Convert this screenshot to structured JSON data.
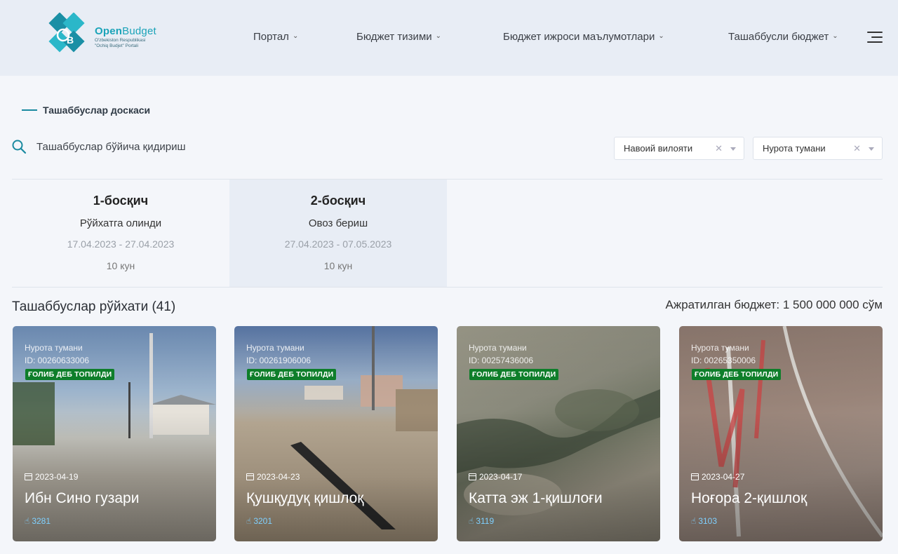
{
  "logo": {
    "name_bold": "Open",
    "name_light": "Budget",
    "sub1": "O'zbekiston Respublikasi",
    "sub2": "\"Ochiq Budjet\" Portali"
  },
  "nav": [
    {
      "label": "Портал"
    },
    {
      "label": "Бюджет тизими"
    },
    {
      "label": "Бюджет ижроси маълумотлари"
    },
    {
      "label": "Ташаббусли бюджет"
    }
  ],
  "section": {
    "label": "Ташаббуслар доскаси"
  },
  "search": {
    "placeholder": "Ташаббуслар бўйича қидириш"
  },
  "filters": {
    "region": "Навоий вилояти",
    "district": "Нурота тумани"
  },
  "stages": [
    {
      "title": "1-босқич",
      "name": "Рўйхатга олинди",
      "dates": "17.04.2023 - 27.04.2023",
      "days": "10 кун",
      "active": false
    },
    {
      "title": "2-босқич",
      "name": "Овоз бериш",
      "dates": "27.04.2023 - 07.05.2023",
      "days": "10 кун",
      "active": true
    }
  ],
  "list": {
    "title": "Ташаббуслар рўйхати (41)",
    "budget": "Ажратилган бюджет: 1 500 000 000 сўм"
  },
  "cards": [
    {
      "district": "Нурота тумани",
      "id": "ID: 00260633006",
      "badge": "ҒОЛИБ ДЕБ ТОПИЛДИ",
      "date": "2023-04-19",
      "title": "Ибн Сино гузари",
      "votes": "3281"
    },
    {
      "district": "Нурота тумани",
      "id": "ID: 00261906006",
      "badge": "ҒОЛИБ ДЕБ ТОПИЛДИ",
      "date": "2023-04-23",
      "title": "Қушқудуқ қишлоқ",
      "votes": "3201"
    },
    {
      "district": "Нурота тумани",
      "id": "ID: 00257436006",
      "badge": "ҒОЛИБ ДЕБ ТОПИЛДИ",
      "date": "2023-04-17",
      "title": "Катта эж 1-қишлоғи",
      "votes": "3119"
    },
    {
      "district": "Нурота тумани",
      "id": "ID: 00265350006",
      "badge": "ҒОЛИБ ДЕБ ТОПИЛДИ",
      "date": "2023-04-27",
      "title": "Ноғора 2-қишлоқ",
      "votes": "3103"
    }
  ],
  "colors": {
    "accent": "#1aa3b8",
    "badge": "#0e7e2a",
    "votes": "#7fd0ff"
  }
}
